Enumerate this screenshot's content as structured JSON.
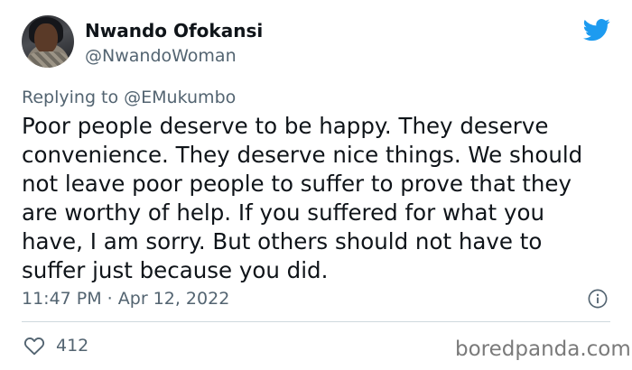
{
  "author": {
    "name": "Nwando Ofokansi",
    "handle": "@NwandoWoman"
  },
  "reply": {
    "prefix": "Replying to ",
    "to": "@EMukumbo"
  },
  "tweet": {
    "lines": [
      "Poor people deserve to be happy. They deserve",
      "convenience. They deserve nice things. We should",
      "not leave poor people to suffer to prove that they",
      "are worthy of help. If you suffered for what you",
      "have, I am sorry. But others should not have to",
      "suffer just because you did."
    ],
    "timestamp": "11:47 PM · Apr 12, 2022",
    "likes": "412"
  },
  "icons": {
    "brand": "twitter-bird-icon",
    "info": "info-icon",
    "like": "heart-icon"
  },
  "colors": {
    "brand_blue": "#1d9bf0",
    "muted": "#536471",
    "text": "#0f1419"
  },
  "watermark": "boredpanda.com"
}
